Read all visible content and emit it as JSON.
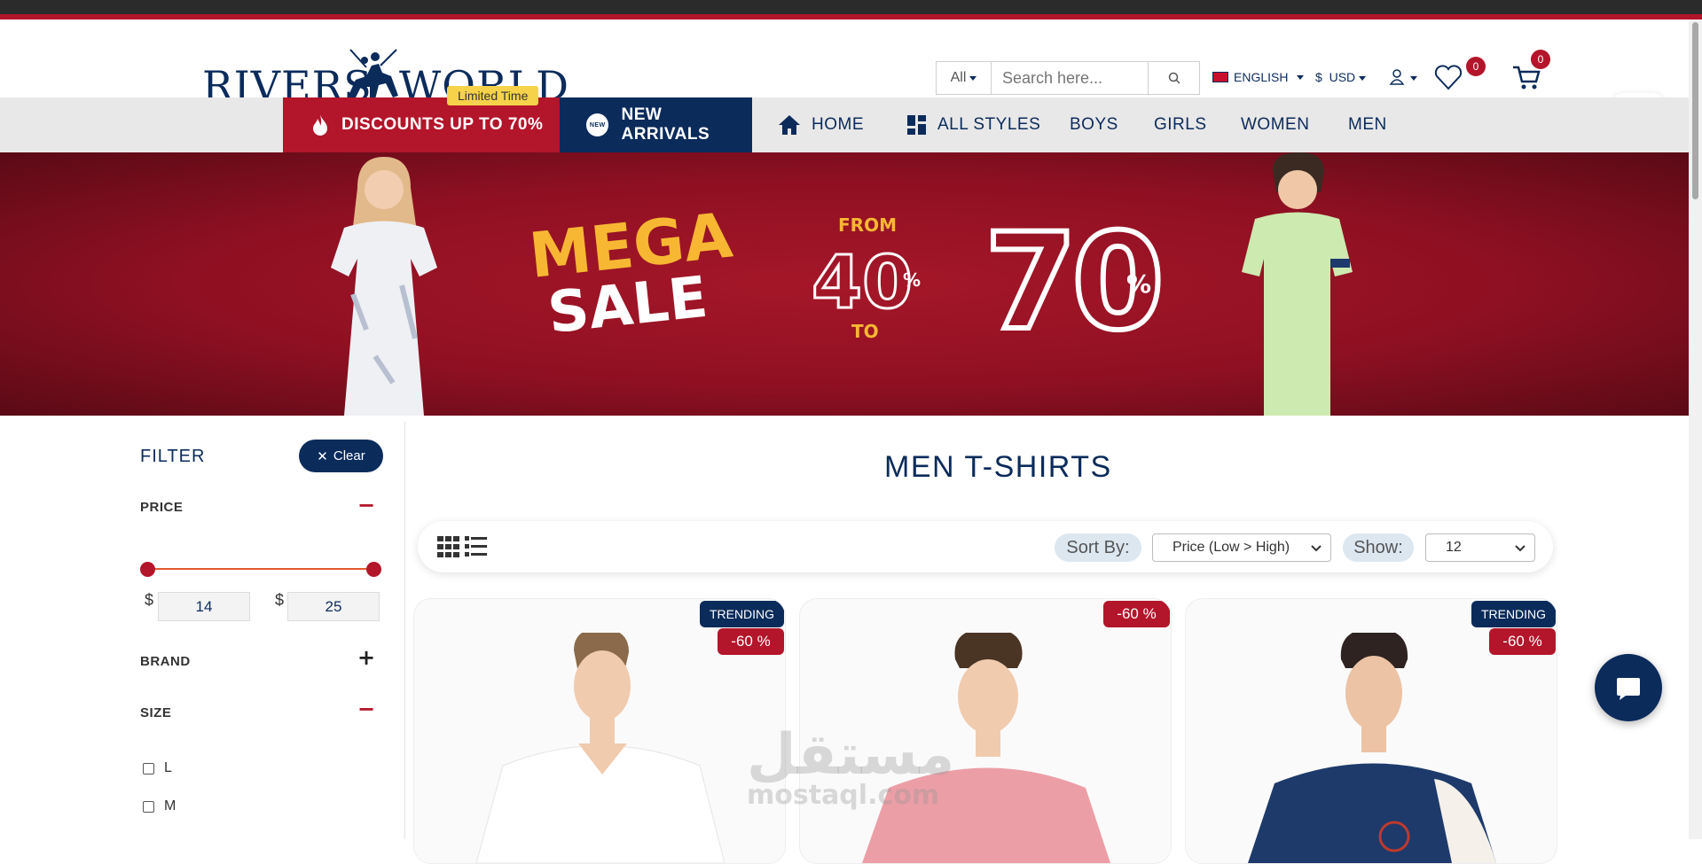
{
  "brand": {
    "left": "RIVERS",
    "right": "WORLD"
  },
  "limited_time": "Limited Time",
  "search": {
    "category": "All",
    "placeholder": "Search here..."
  },
  "language": "ENGLISH",
  "currency": {
    "symbol": "$",
    "code": "USD"
  },
  "wishlist_count": "0",
  "cart_count": "0",
  "nav": {
    "discounts": "DISCOUNTS UP TO 70%",
    "new_badge": "NEW",
    "new_arrivals": "NEW ARRIVALS",
    "home": "HOME",
    "all_styles": "ALL STYLES",
    "boys": "BOYS",
    "girls": "GIRLS",
    "women": "WOMEN",
    "men": "MEN"
  },
  "banner": {
    "mega": "MEGA",
    "sale": "SALE",
    "from": "FROM",
    "low": "40",
    "low_pct": "%",
    "to": "TO",
    "high": "70",
    "high_pct": "%"
  },
  "filter": {
    "title": "FILTER",
    "clear": "Clear",
    "price": {
      "label": "PRICE",
      "currency": "$",
      "min": "14",
      "max": "25"
    },
    "brand": "BRAND",
    "size": {
      "label": "SIZE",
      "options": [
        "L",
        "M"
      ]
    }
  },
  "page_title": "MEN T-SHIRTS",
  "toolbar": {
    "sort_label": "Sort By:",
    "sort_value": "Price (Low > High)",
    "show_label": "Show:",
    "show_value": "12"
  },
  "products": [
    {
      "trending": "TRENDING",
      "discount": "-60 %"
    },
    {
      "trending": "",
      "discount": "-60 %"
    },
    {
      "trending": "TRENDING",
      "discount": "-60 %"
    }
  ],
  "watermark": {
    "arabic": "مستقل",
    "latin": "mostaql.com"
  },
  "colors": {
    "navy": "#0b2b5b",
    "red": "#b3152a",
    "gold": "#f7b733"
  }
}
